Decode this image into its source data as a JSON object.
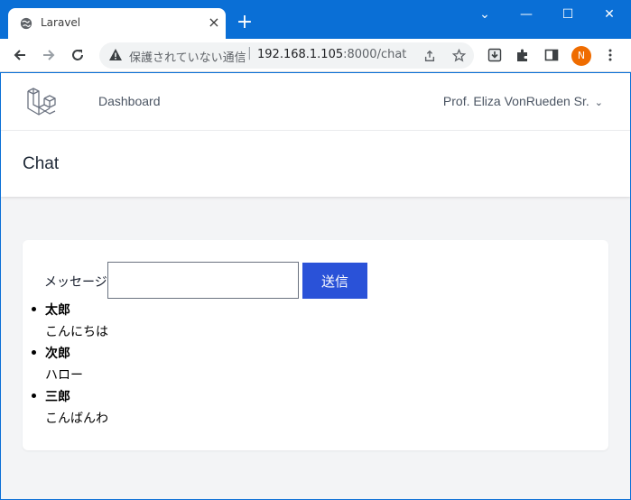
{
  "browser": {
    "tab_title": "Laravel",
    "tab_close": "×",
    "new_tab": "+",
    "window_controls": {
      "dropdown": "⌄",
      "minimize": "—",
      "maximize": "☐",
      "close": "✕"
    },
    "omnibox": {
      "security_label": "保護されていない通信",
      "separator": "|",
      "url_host": "192.168.1.105",
      "url_rest": ":8000/chat"
    },
    "profile_initial": "N"
  },
  "icons": {
    "back": "arrow-left-icon",
    "forward": "arrow-right-icon",
    "reload": "reload-icon",
    "share": "share-icon",
    "star": "star-icon",
    "download": "download-icon",
    "extensions": "puzzle-icon",
    "sidepanel": "side-panel-icon",
    "menu": "kebab-menu-icon"
  },
  "app": {
    "nav": {
      "dashboard_label": "Dashboard",
      "user_name": "Prof. Eliza VonRueden Sr."
    },
    "header": {
      "title": "Chat"
    },
    "chat": {
      "form_label": "メッセージ :",
      "input_value": "",
      "input_placeholder": "",
      "send_label": "送信",
      "messages": [
        {
          "name": "太郎",
          "text": "こんにちは"
        },
        {
          "name": "次郎",
          "text": "ハロー"
        },
        {
          "name": "三郎",
          "text": "こんばんわ"
        }
      ]
    }
  },
  "colors": {
    "browser_frame": "#0a6fd6",
    "send_button": "#2a52d8",
    "profile_avatar": "#ef6c00",
    "laravel_logo": "#6b7280",
    "page_background": "#f3f4f6"
  }
}
